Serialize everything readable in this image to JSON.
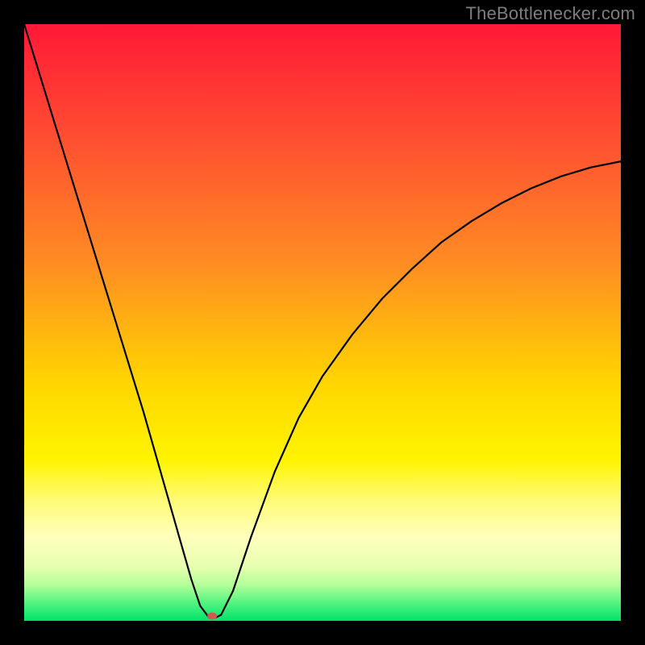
{
  "watermark": "TheBottlenecker.com",
  "chart_data": {
    "type": "line",
    "title": "",
    "xlabel": "",
    "ylabel": "",
    "xlim": [
      0,
      100
    ],
    "ylim": [
      0,
      100
    ],
    "grid": false,
    "legend": false,
    "background_gradient": {
      "stops": [
        {
          "offset": 0.0,
          "color": "#ff1837"
        },
        {
          "offset": 0.2,
          "color": "#ff5131"
        },
        {
          "offset": 0.4,
          "color": "#ff8c23"
        },
        {
          "offset": 0.6,
          "color": "#ffd500"
        },
        {
          "offset": 0.73,
          "color": "#fff400"
        },
        {
          "offset": 0.8,
          "color": "#fffb7a"
        },
        {
          "offset": 0.86,
          "color": "#ffffbc"
        },
        {
          "offset": 0.91,
          "color": "#e6ffb0"
        },
        {
          "offset": 0.94,
          "color": "#b3ff9a"
        },
        {
          "offset": 0.97,
          "color": "#53f47f"
        },
        {
          "offset": 1.0,
          "color": "#00e36c"
        }
      ]
    },
    "series": [
      {
        "name": "bottleneck-curve",
        "color": "#000000",
        "stroke_width": 2.2,
        "x": [
          0,
          4,
          8,
          12,
          16,
          20,
          24,
          26,
          28,
          29.5,
          31,
          32,
          33,
          35,
          38,
          42,
          46,
          50,
          55,
          60,
          65,
          70,
          75,
          80,
          85,
          90,
          95,
          100
        ],
        "y": [
          100,
          87,
          74,
          61,
          48,
          35,
          21,
          14,
          7,
          2.5,
          0.5,
          0.5,
          1.0,
          5,
          14,
          25,
          34,
          41,
          48,
          54,
          59,
          63.5,
          67,
          70,
          72.5,
          74.5,
          76,
          77
        ]
      }
    ],
    "marker": {
      "name": "optimum-point",
      "x": 31.5,
      "y": 0.8,
      "rx": 6,
      "ry": 4.5,
      "color": "#cf5a50"
    }
  }
}
